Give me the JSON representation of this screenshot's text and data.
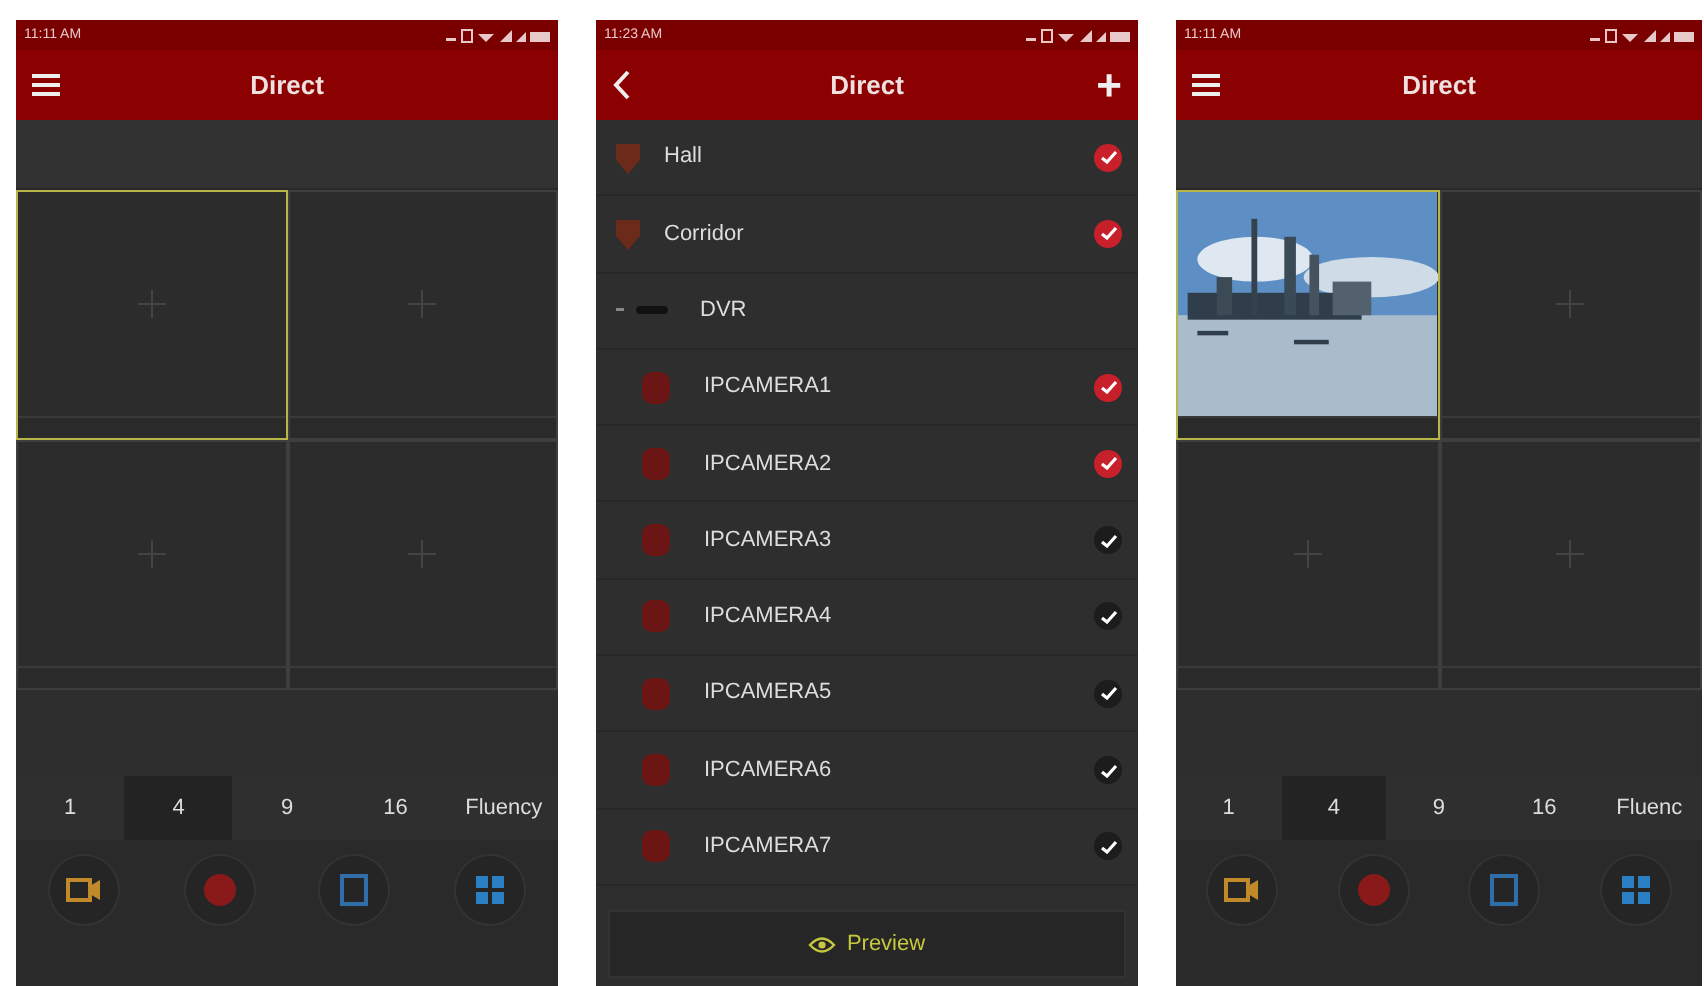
{
  "phones": [
    {
      "kind": "grid",
      "status_time": "11:11 AM",
      "title": "Direct",
      "cells": [
        {
          "kind": "empty",
          "selected": true
        },
        {
          "kind": "empty",
          "selected": false
        },
        {
          "kind": "empty",
          "selected": false
        },
        {
          "kind": "empty",
          "selected": false
        }
      ],
      "split_tabs": [
        {
          "label": "1",
          "selected": false
        },
        {
          "label": "4",
          "selected": true
        },
        {
          "label": "9",
          "selected": false
        },
        {
          "label": "16",
          "selected": false
        },
        {
          "label": "Fluency",
          "selected": false
        }
      ]
    },
    {
      "kind": "list",
      "status_time": "11:23 AM",
      "title": "Direct",
      "add": "+",
      "devices": [
        {
          "label": "Hall",
          "selected": true
        },
        {
          "label": "Corridor",
          "selected": true
        },
        {
          "label": "DVR",
          "children": [
            {
              "label": "IPCAMERA1",
              "selected": true
            },
            {
              "label": "IPCAMERA2",
              "selected": true
            },
            {
              "label": "IPCAMERA3",
              "selected": false
            },
            {
              "label": "IPCAMERA4",
              "selected": false
            },
            {
              "label": "IPCAMERA5",
              "selected": false
            },
            {
              "label": "IPCAMERA6",
              "selected": false
            },
            {
              "label": "IPCAMERA7",
              "selected": false
            }
          ]
        }
      ],
      "preview_button": "Preview"
    },
    {
      "kind": "grid",
      "status_time": "11:11 AM",
      "title": "Direct",
      "cells": [
        {
          "kind": "picture",
          "selected": true
        },
        {
          "kind": "empty",
          "selected": false
        },
        {
          "kind": "empty",
          "selected": false
        },
        {
          "kind": "empty",
          "selected": false
        }
      ],
      "split_tabs": [
        {
          "label": "1",
          "selected": false
        },
        {
          "label": "4",
          "selected": true
        },
        {
          "label": "9",
          "selected": false
        },
        {
          "label": "16",
          "selected": false
        },
        {
          "label": "Fluenc",
          "selected": false
        }
      ]
    }
  ]
}
